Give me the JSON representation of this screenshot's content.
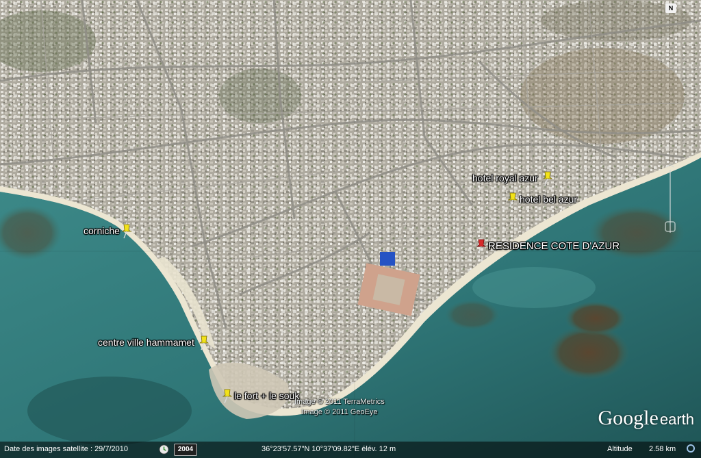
{
  "placemarks": [
    {
      "id": "corniche",
      "label": "corniche",
      "color": "#f2e21a"
    },
    {
      "id": "centre",
      "label": "centre ville hammamet",
      "color": "#f2e21a"
    },
    {
      "id": "fort",
      "label": "le fort + le souk",
      "color": "#f2e21a"
    },
    {
      "id": "royal",
      "label": "hotel royal azur",
      "color": "#f2e21a"
    },
    {
      "id": "bel",
      "label": "hotel bel azur",
      "color": "#f2e21a"
    },
    {
      "id": "residence",
      "label": "RESIDENCE COTE D'AZUR",
      "color": "#d62b2b"
    }
  ],
  "credits": {
    "line1": "Image © 2011 TerraMetrics",
    "line2": "Image © 2011 GeoEye"
  },
  "logo": {
    "brand": "Google",
    "product": "earth"
  },
  "compass": {
    "north_label": "N"
  },
  "status": {
    "imagery_date": "Date des images satellite : 29/7/2010",
    "year": "2004",
    "coordinates": "36°23'57.57\"N  10°37'09.82\"E  élév.   12 m",
    "altitude_label": "Altitude",
    "altitude_value": "2.58 km"
  },
  "colors": {
    "sea_shallow": "#3f8c8a",
    "sea_deep": "#215859",
    "land": "#b9b6ac",
    "beach": "#e8e2cf",
    "reef": "#5b4a35"
  },
  "icons": {
    "pin": "pushpin-icon",
    "history": "history-clock-icon",
    "north": "north-arrow-icon"
  }
}
